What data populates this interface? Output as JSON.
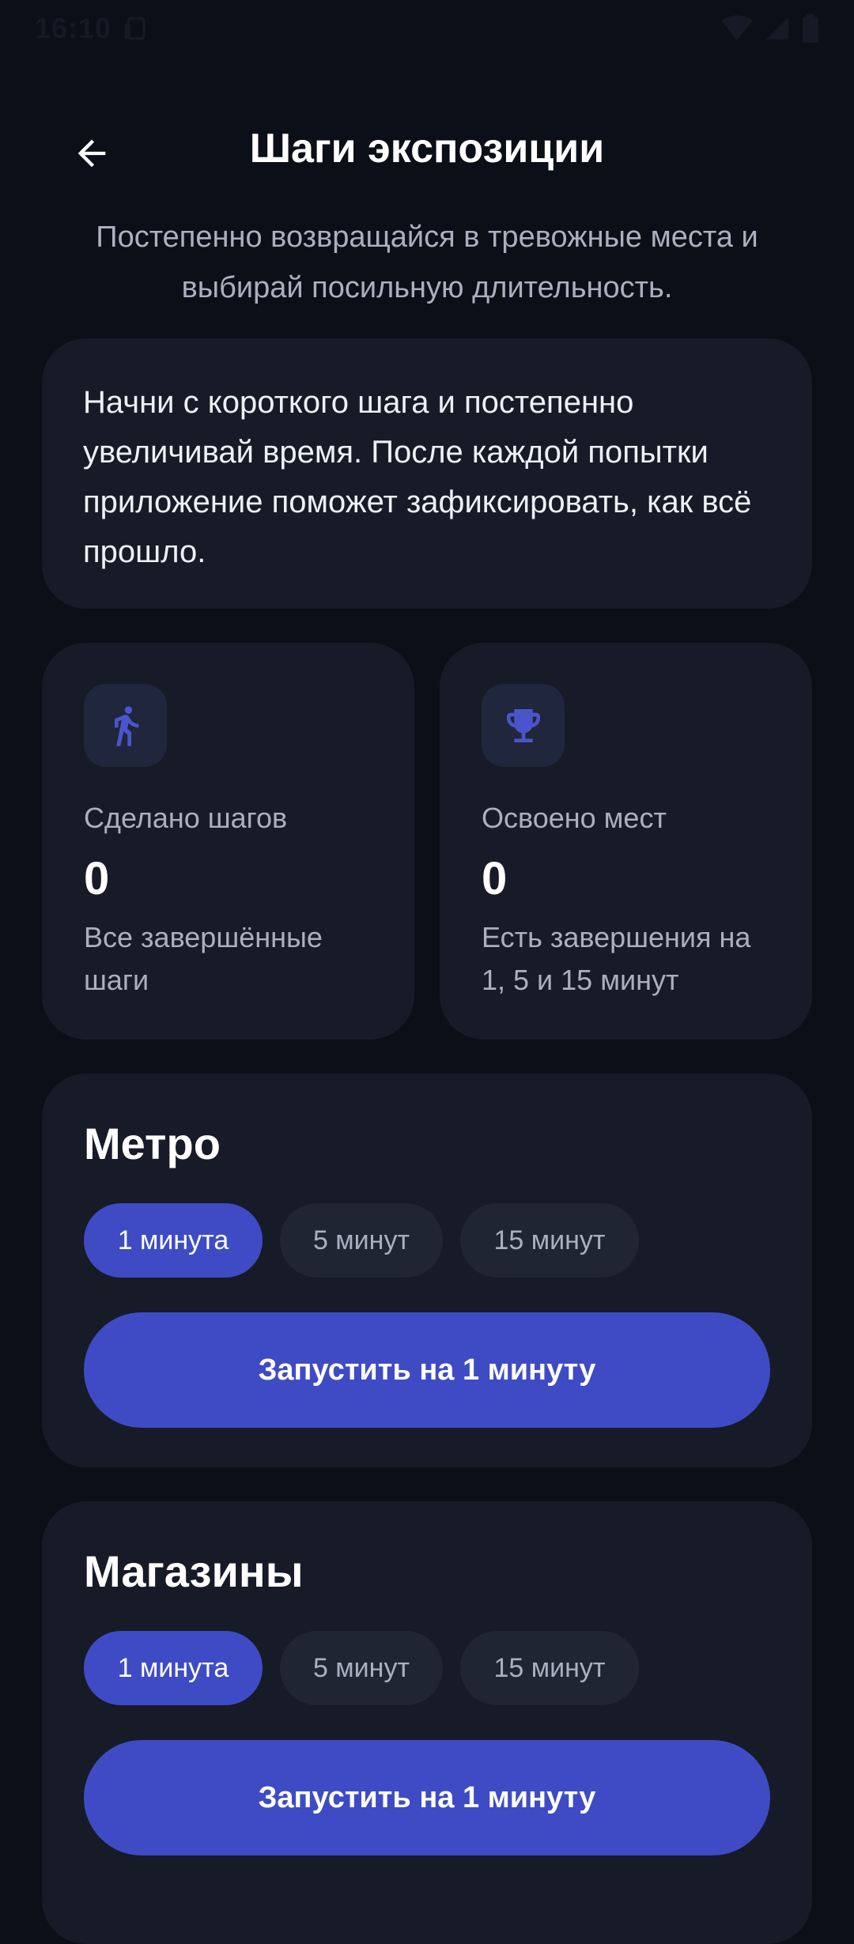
{
  "status_bar": {
    "time": "16:10"
  },
  "header": {
    "title": "Шаги экспозиции",
    "subtitle": "Постепенно возвращайся в тревожные места и выбирай посильную длительность."
  },
  "info": {
    "text": "Начни с короткого шага и постепенно увеличивай время. После каждой попытки приложение поможет зафиксировать, как всё прошло."
  },
  "stats": [
    {
      "icon": "walking-person-icon",
      "label": "Сделано шагов",
      "value": "0",
      "description": "Все завершённые шаги"
    },
    {
      "icon": "trophy-icon",
      "label": "Освоено мест",
      "value": "0",
      "description": "Есть завершения на 1, 5 и 15 минут"
    }
  ],
  "places": [
    {
      "title": "Метро",
      "chips": [
        "1 минута",
        "5 минут",
        "15 минут"
      ],
      "selected_chip": 0,
      "start_label": "Запустить на 1 минуту"
    },
    {
      "title": "Магазины",
      "chips": [
        "1 минута",
        "5 минут",
        "15 минут"
      ],
      "selected_chip": 0,
      "start_label": "Запустить на 1 минуту"
    }
  ],
  "colors": {
    "background": "#0b0f17",
    "card": "#161b27",
    "accent": "#3f4bc4",
    "chip_idle": "#1f2532",
    "muted_text": "#a9b0bf"
  }
}
